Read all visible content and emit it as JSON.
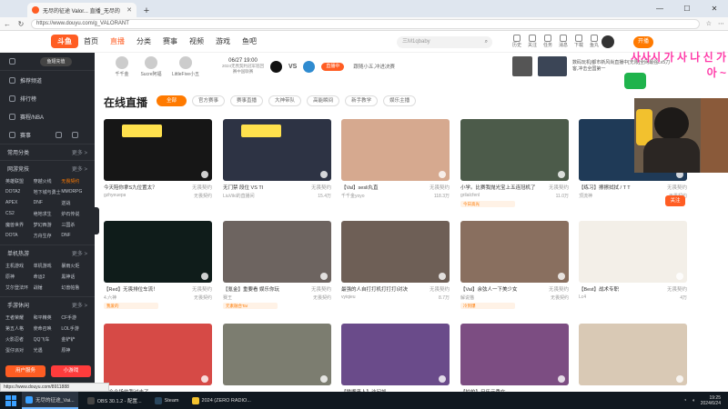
{
  "browser": {
    "tab_title": "无尽的征途 Valor... 直播_无尽的",
    "url": "https://www.douyu.com/g_VALORANT",
    "new_tab": "+",
    "win_min": "—",
    "win_max": "☐",
    "win_close": "✕"
  },
  "header": {
    "logo": "斗鱼",
    "nav": [
      "首页",
      "直播",
      "分类",
      "赛事",
      "视频",
      "游戏",
      "鱼吧"
    ],
    "search_placeholder": "三M1qbaby",
    "icons": [
      {
        "name": "history-icon",
        "label": "历史"
      },
      {
        "name": "follow-icon",
        "label": "关注"
      },
      {
        "name": "task-icon",
        "label": "任务"
      },
      {
        "name": "message-icon",
        "label": "消息"
      },
      {
        "name": "download-icon",
        "label": "下载"
      },
      {
        "name": "fish-icon",
        "label": "鱼丸"
      }
    ],
    "open_button": "开播"
  },
  "sidebar": {
    "user_badge": "鱼翅充值",
    "rows": [
      {
        "icon": "home-icon",
        "label": "推荐频道"
      },
      {
        "icon": "rank-icon",
        "label": "排行榜"
      },
      {
        "icon": "hot-icon",
        "label": "赛程/NBA"
      },
      {
        "icon": "shield-icon",
        "label": "赛事"
      }
    ],
    "section_common": "常用分类",
    "section_game": "网游竞技",
    "more": "更多 >",
    "game_items": [
      {
        "t": "英雄联盟",
        "hot": false
      },
      {
        "t": "穿越火线",
        "hot": false
      },
      {
        "t": "无畏契约",
        "hot": true
      },
      {
        "t": "DOTA2",
        "hot": false
      },
      {
        "t": "地下城与勇士",
        "hot": false
      },
      {
        "t": "MMORPG",
        "hot": false
      },
      {
        "t": "APEX",
        "hot": false
      },
      {
        "t": "DNF",
        "hot": false
      },
      {
        "t": "逆战",
        "hot": false
      },
      {
        "t": "CS2",
        "hot": false
      },
      {
        "t": "绝地求生",
        "hot": false
      },
      {
        "t": "炉石传说",
        "hot": false
      },
      {
        "t": "魔兽世界",
        "hot": false
      },
      {
        "t": "梦幻西游",
        "hot": false
      },
      {
        "t": "三国杀",
        "hot": false
      },
      {
        "t": "DOTA",
        "hot": false
      },
      {
        "t": "方舟生存",
        "hot": false
      },
      {
        "t": "DNF",
        "hot": false
      }
    ],
    "section_single": "单机热游",
    "single_items": [
      {
        "t": "主机游戏",
        "hot": false
      },
      {
        "t": "单机游戏",
        "hot": false
      },
      {
        "t": "暴雨火炬",
        "hot": false
      },
      {
        "t": "原神",
        "hot": false
      },
      {
        "t": "命运2",
        "hot": false
      },
      {
        "t": "黑神话",
        "hot": false
      },
      {
        "t": "艾尔登法环",
        "hot": false
      },
      {
        "t": "战锤",
        "hot": false
      },
      {
        "t": "幻兽帕鲁",
        "hot": false
      }
    ],
    "section_mobile": "手游休闲",
    "mobile_items": [
      {
        "t": "王者荣耀",
        "hot": false
      },
      {
        "t": "和平精英",
        "hot": false
      },
      {
        "t": "CF手游",
        "hot": false
      },
      {
        "t": "第五人格",
        "hot": false
      },
      {
        "t": "使命召唤",
        "hot": false
      },
      {
        "t": "LOL手游",
        "hot": false
      },
      {
        "t": "火影忍者",
        "hot": false
      },
      {
        "t": "QQ飞车",
        "hot": false
      },
      {
        "t": "金铲铲",
        "hot": false
      },
      {
        "t": "蛋仔派对",
        "hot": false
      },
      {
        "t": "光遇",
        "hot": false
      },
      {
        "t": "原神",
        "hot": false
      }
    ],
    "btn_left": "用户服务",
    "btn_right": "小游戏"
  },
  "match": {
    "p1": "千千金",
    "p2": "Sucre阿福",
    "p3": "LittleFive小五",
    "date": "06/27 19:00",
    "date_sub": "2024无畏契约冠军巡回赛中国联赛",
    "vs": "VS",
    "live": "直播中",
    "sub": "跟随小五,冲进决赛"
  },
  "rbanner": {
    "text": "数码玩机|都市新风尚直播中[无限]全网最强Lv5刀客,冲击全国第一",
    "extra": "小猪唱歌"
  },
  "section": {
    "title": "在线直播",
    "filters": [
      "全部",
      "官方赛事",
      "赛事直播",
      "大神带队",
      "高能瞬间",
      "新手教学",
      "娱乐主播"
    ]
  },
  "cards": [
    {
      "tag": "无畏契约",
      "title": "今天陪你拿S九位置太？",
      "user": "gzhyeuepa",
      "count": "无畏契约",
      "badge": "",
      "col": 0,
      "row": 0,
      "bg": "#161616"
    },
    {
      "tag": "无畏契约",
      "title": "无门禁 段位 VS TI",
      "user": "LiuViki的直播间",
      "count": "15.4万",
      "badge": "",
      "col": 1,
      "row": 0,
      "bg": "#2d3344"
    },
    {
      "tag": "无畏契约",
      "title": "【Val】sesli丸直",
      "user": "千千金yoyo",
      "count": "118.3万",
      "badge": "",
      "col": 2,
      "row": 0,
      "bg": "#d6a98f"
    },
    {
      "tag": "无畏契约",
      "title": "小学。比赛我抛光宝上五连冠机了",
      "user": "grilalcfenl",
      "count": "11.0万",
      "badge": "今日高光",
      "col": 3,
      "row": 0,
      "bg": "#4c5b4a"
    },
    {
      "tag": "无畏契约",
      "title": "【练习】擦擦拭拭 / T T",
      "user": "顶流神",
      "count": "无畏契约",
      "badge": "",
      "col": 4,
      "row": 0,
      "bg": "#1f3a57"
    },
    {
      "tag": "无畏契约",
      "title": "【Red】无畏排位车流！",
      "user": "4.六神",
      "count": "无畏契约",
      "badge": "我爱的",
      "col": 0,
      "row": 1,
      "bg": "#0f1c1a"
    },
    {
      "tag": "无畏契约",
      "title": "【氪金】重要看 娱乐你玩",
      "user": "赛王",
      "count": "无畏契约",
      "badge": "元素融合Tar",
      "col": 1,
      "row": 1,
      "bg": "#6d6460"
    },
    {
      "tag": "无畏契约",
      "title": "最强的人自打打机打打打I对决",
      "user": "vyiqieu",
      "count": "8.7万",
      "badge": "",
      "col": 2,
      "row": 1,
      "bg": "#6e5f56"
    },
    {
      "tag": "无畏契约",
      "title": "【Val】余弦人一下美少女",
      "user": "解说猫",
      "count": "无畏契约",
      "badge": "冷到爆",
      "col": 3,
      "row": 1,
      "bg": "#896f5f"
    },
    {
      "tag": "无畏契约",
      "title": "【Best】战术专职",
      "user": "Lc4",
      "count": "4万",
      "badge": "",
      "col": 4,
      "row": 1,
      "bg": "#f3efe8"
    },
    {
      "tag": "",
      "title": "文会会场的我过去了",
      "user": "",
      "count": "",
      "badge": "",
      "col": 0,
      "row": 2,
      "bg": "#d64a46"
    },
    {
      "tag": "",
      "title": "",
      "user": "",
      "count": "",
      "badge": "",
      "col": 1,
      "row": 2,
      "bg": "#7c7d70"
    },
    {
      "tag": "",
      "title": "【猫嘴来人】访问加",
      "user": "",
      "count": "",
      "badge": "",
      "col": 2,
      "row": 2,
      "bg": "#6a4b8a"
    },
    {
      "tag": "",
      "title": "【拍拍】只乐元秀在",
      "user": "",
      "count": "",
      "badge": "",
      "col": 3,
      "row": 2,
      "bg": "#7c4d82"
    },
    {
      "tag": "",
      "title": "",
      "user": "",
      "count": "",
      "badge": "",
      "col": 4,
      "row": 2,
      "bg": "#d9c9b5"
    }
  ],
  "pip": {
    "overlay": "사사시 가 사 나 신 가 아 ~",
    "follow": "关注"
  },
  "statusbar": "https://www.douyu.com/8911888",
  "taskbar": {
    "apps": [
      {
        "label": "无尽的征途_Vai...",
        "color": "#3aa0ff",
        "active": true
      },
      {
        "label": "OBS 30.1.2 - 配置...",
        "color": "#444444",
        "active": false
      },
      {
        "label": "Steam",
        "color": "#2a475e",
        "active": false
      },
      {
        "label": "2024 (ZERO RADIO...",
        "color": "#f2c12e",
        "active": false
      }
    ],
    "time": "19:25",
    "date": "2024/6/24"
  },
  "colors": {
    "brand": "#ff5d23",
    "accent": "#ff7a00",
    "sidebar": "#25282e"
  }
}
